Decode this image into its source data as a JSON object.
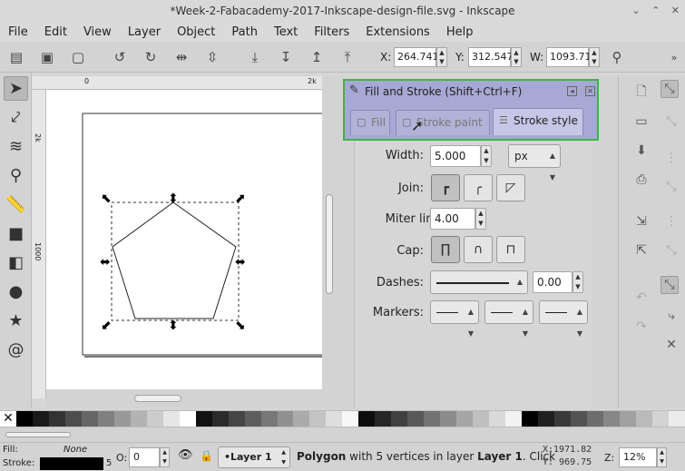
{
  "window": {
    "title": "*Week-2-Fabacademy-2017-Inkscape-design-file.svg - Inkscape",
    "controls": [
      "⌄",
      "⌃",
      "✕"
    ]
  },
  "menu": [
    "File",
    "Edit",
    "View",
    "Layer",
    "Object",
    "Path",
    "Text",
    "Filters",
    "Extensions",
    "Help"
  ],
  "toolbar": {
    "x_label": "X:",
    "x_value": "264.741",
    "y_label": "Y:",
    "y_value": "312.547",
    "w_label": "W:",
    "w_value": "1093.71"
  },
  "rulers": {
    "h_ticks": [
      "0",
      "2k"
    ],
    "v_ticks": [
      "2k",
      "1000"
    ]
  },
  "dock": {
    "title": "Fill and Stroke (Shift+Ctrl+F)",
    "tabs": [
      {
        "label": "Fill",
        "active": false
      },
      {
        "label": "Stroke paint",
        "active": false
      },
      {
        "label": "Stroke style",
        "active": true
      }
    ],
    "width_label": "Width:",
    "width_value": "5.000",
    "unit": "px",
    "join_label": "Join:",
    "miter_label": "Miter limit:",
    "miter_value": "4.00",
    "cap_label": "Cap:",
    "dashes_label": "Dashes:",
    "dash_offset": "0.00",
    "markers_label": "Markers:"
  },
  "palette": {
    "colors": [
      "#000000",
      "#1a1a1a",
      "#333333",
      "#4d4d4d",
      "#666666",
      "#808080",
      "#999999",
      "#b3b3b3",
      "#cccccc",
      "#e6e6e6",
      "#ffffff",
      "#111111",
      "#2b2b2b",
      "#454545",
      "#5e5e5e",
      "#787878",
      "#919191",
      "#ababab",
      "#c4c4c4",
      "#dedede",
      "#f7f7f7",
      "#0d0d0d",
      "#262626",
      "#404040",
      "#595959",
      "#737373",
      "#8c8c8c",
      "#a6a6a6",
      "#bfbfbf",
      "#d9d9d9",
      "#f2f2f2",
      "#000000",
      "#202020",
      "#3a3a3a",
      "#535353",
      "#6d6d6d",
      "#878787",
      "#a0a0a0",
      "#bababa",
      "#d3d3d3",
      "#ececec"
    ]
  },
  "status": {
    "fill_label": "Fill:",
    "fill_value": "None",
    "stroke_label": "Stroke:",
    "stroke_width": "5",
    "opacity_label": "O:",
    "opacity_value": "0",
    "layer": "•Layer 1",
    "message_bold": "Polygon",
    "message_mid": " with 5 vertices in layer ",
    "message_layer": "Layer 1",
    "message_end": ". Click",
    "x_coord": "X:1971.82",
    "y_coord": "Y: 969.75",
    "zoom_label": "Z:",
    "zoom_value": "12%"
  }
}
